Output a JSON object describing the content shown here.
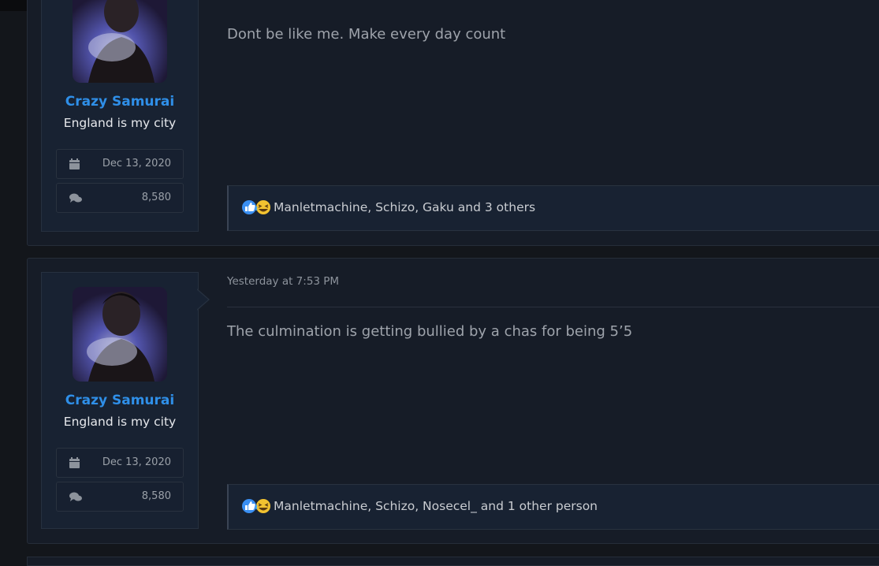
{
  "posts": [
    {
      "username": "Crazy Samurai",
      "user_title": "England is my city",
      "joined": "Dec 13, 2020",
      "messages": "8,580",
      "date": "",
      "body": "Dont be like me. Make every day count",
      "reactions_text": "Manletmachine, Schizo, Gaku and 3 others",
      "reaction_icons": [
        "like-icon",
        "laugh-icon"
      ]
    },
    {
      "username": "Crazy Samurai",
      "user_title": "England is my city",
      "joined": "Dec 13, 2020",
      "messages": "8,580",
      "date": "Yesterday at 7:53 PM",
      "body": "The culmination is getting bullied by a chas for being 5’5",
      "reactions_text": "Manletmachine, Schizo, Nosecel_ and 1 other person",
      "reaction_icons": [
        "like-icon",
        "laugh-icon"
      ]
    }
  ],
  "colors": {
    "username": "#2f8fe8",
    "background": "#13161b",
    "post_bg": "#161c27",
    "user_cell_bg": "#182232"
  }
}
